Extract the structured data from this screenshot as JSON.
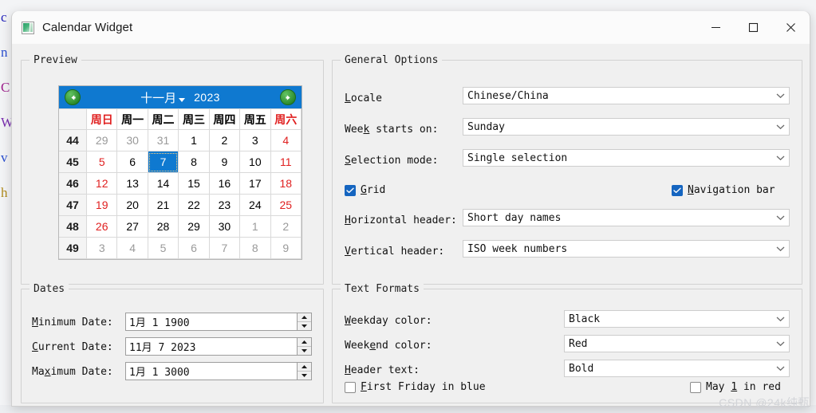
{
  "window": {
    "title": "Calendar Widget",
    "icon": "calendar-app-icon",
    "controls": [
      {
        "name": "minimize",
        "glyph": "minimize-icon"
      },
      {
        "name": "maximize",
        "glyph": "maximize-icon"
      },
      {
        "name": "close",
        "glyph": "close-icon"
      }
    ]
  },
  "desktop": {
    "edge_text": [
      "c",
      "n",
      "C",
      "W",
      "v",
      "h"
    ]
  },
  "preview": {
    "title": "Preview",
    "nav": {
      "prev": "previous-month-arrow",
      "next": "next-month-arrow",
      "month": "十一月",
      "year": "2023"
    },
    "headers": [
      "",
      "周日",
      "周一",
      "周二",
      "周三",
      "周四",
      "周五",
      "周六"
    ],
    "weeks": [
      {
        "num": "44",
        "days": [
          "29",
          "30",
          "31",
          "1",
          "2",
          "3",
          "4"
        ],
        "states": [
          "dim",
          "dim",
          "dim",
          "",
          "",
          "",
          "wkend"
        ]
      },
      {
        "num": "45",
        "days": [
          "5",
          "6",
          "7",
          "8",
          "9",
          "10",
          "11"
        ],
        "states": [
          "wkend",
          "",
          "sel",
          "",
          "",
          "",
          "wkend"
        ]
      },
      {
        "num": "46",
        "days": [
          "12",
          "13",
          "14",
          "15",
          "16",
          "17",
          "18"
        ],
        "states": [
          "wkend",
          "",
          "",
          "",
          "",
          "",
          "wkend"
        ]
      },
      {
        "num": "47",
        "days": [
          "19",
          "20",
          "21",
          "22",
          "23",
          "24",
          "25"
        ],
        "states": [
          "wkend",
          "",
          "",
          "",
          "",
          "",
          "wkend"
        ]
      },
      {
        "num": "48",
        "days": [
          "26",
          "27",
          "28",
          "29",
          "30",
          "1",
          "2"
        ],
        "states": [
          "wkend",
          "",
          "",
          "",
          "",
          "dim",
          "dim"
        ]
      },
      {
        "num": "49",
        "days": [
          "3",
          "4",
          "5",
          "6",
          "7",
          "8",
          "9"
        ],
        "states": [
          "dim",
          "dim",
          "dim",
          "dim",
          "dim",
          "dim",
          "dim"
        ]
      }
    ],
    "selected_date": "7",
    "colors": {
      "navbar": "#0f79d0",
      "selection": "#0f79d0",
      "weekend": "#e02020"
    }
  },
  "general_options": {
    "title": "General Options",
    "locale": {
      "label": "Locale",
      "mnemonic": "L",
      "value": "Chinese/China"
    },
    "week_starts_on": {
      "label": "Week starts on:",
      "mnemonic": "k",
      "value": "Sunday"
    },
    "selection_mode": {
      "label": "Selection mode:",
      "mnemonic": "S",
      "value": "Single selection"
    },
    "grid": {
      "label": "Grid",
      "mnemonic": "G",
      "checked": true
    },
    "navigation_bar": {
      "label": "Navigation bar",
      "mnemonic": "N",
      "checked": true
    },
    "horizontal_header": {
      "label": "Horizontal header:",
      "mnemonic": "H",
      "value": "Short day names"
    },
    "vertical_header": {
      "label": "Vertical header:",
      "mnemonic": "V",
      "value": "ISO week numbers"
    }
  },
  "dates": {
    "title": "Dates",
    "minimum": {
      "label": "Minimum Date:",
      "mnemonic": "M",
      "value": "1月 1 1900"
    },
    "current": {
      "label": "Current Date:",
      "mnemonic": "C",
      "value": "11月 7 2023"
    },
    "maximum": {
      "label": "Maximum Date:",
      "mnemonic": "x",
      "value": "1月 1 3000"
    }
  },
  "text_formats": {
    "title": "Text Formats",
    "weekday_color": {
      "label": "Weekday color:",
      "mnemonic": "W",
      "value": "Black"
    },
    "weekend_color": {
      "label": "Weekend color:",
      "mnemonic": "e",
      "value": "Red"
    },
    "header_text": {
      "label": "Header text:",
      "mnemonic": "H",
      "value": "Bold"
    },
    "first_friday": {
      "label": "First Friday in blue",
      "mnemonic": "F",
      "checked": false
    },
    "may_first": {
      "label": "May 1 in red",
      "mnemonic": "1",
      "checked": false
    }
  },
  "watermark": "CSDN @24k纯甄"
}
